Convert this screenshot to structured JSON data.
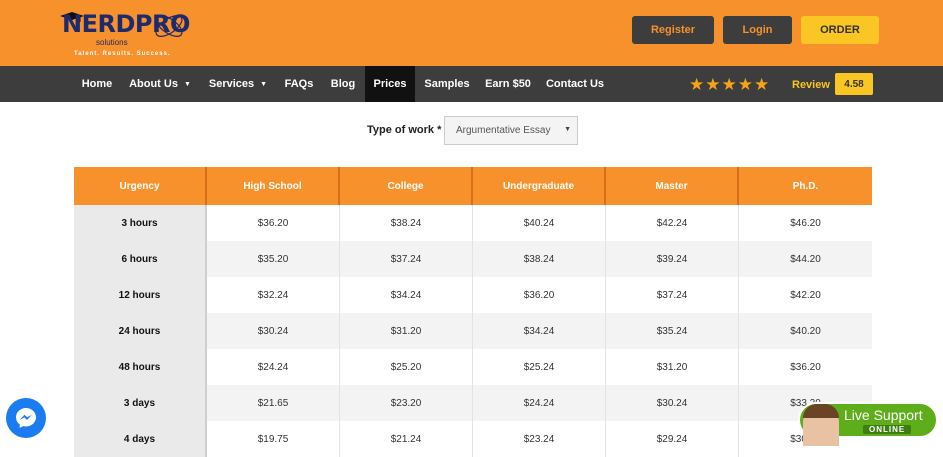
{
  "header": {
    "logo": {
      "brand": "NERDPRO",
      "sub": "solutions",
      "tagline": "Talent. Results. Success."
    },
    "buttons": {
      "register": "Register",
      "login": "Login",
      "order": "ORDER"
    }
  },
  "nav": {
    "items": [
      {
        "label": "Home"
      },
      {
        "label": "About Us"
      },
      {
        "label": "Services"
      },
      {
        "label": "FAQs"
      },
      {
        "label": "Blog"
      },
      {
        "label": "Prices"
      },
      {
        "label": "Samples"
      },
      {
        "label": "Earn $50"
      },
      {
        "label": "Contact Us"
      }
    ],
    "rating_stars": 5,
    "review_label": "Review",
    "review_score": "4.58"
  },
  "type_of_work": {
    "label": "Type of work *",
    "value": "Argumentative Essay"
  },
  "price_table": {
    "headers": [
      "Urgency",
      "High School",
      "College",
      "Undergraduate",
      "Master",
      "Ph.D."
    ],
    "rows": [
      [
        "3 hours",
        "$36.20",
        "$38.24",
        "$40.24",
        "$42.24",
        "$46.20"
      ],
      [
        "6 hours",
        "$35.20",
        "$37.24",
        "$38.24",
        "$39.24",
        "$44.20"
      ],
      [
        "12 hours",
        "$32.24",
        "$34.24",
        "$36.20",
        "$37.24",
        "$42.20"
      ],
      [
        "24 hours",
        "$30.24",
        "$31.20",
        "$34.24",
        "$35.24",
        "$40.20"
      ],
      [
        "48 hours",
        "$24.24",
        "$25.20",
        "$25.24",
        "$31.20",
        "$36.20"
      ],
      [
        "3 days",
        "$21.65",
        "$23.20",
        "$24.24",
        "$30.24",
        "$33.20"
      ],
      [
        "4 days",
        "$19.75",
        "$21.24",
        "$23.24",
        "$29.24",
        "$30.24"
      ]
    ]
  },
  "live_support": {
    "title": "Live Support",
    "status": "ONLINE"
  },
  "colors": {
    "accent": "#f7912b",
    "dark": "#3d3d3d",
    "yellow": "#f9c623"
  }
}
